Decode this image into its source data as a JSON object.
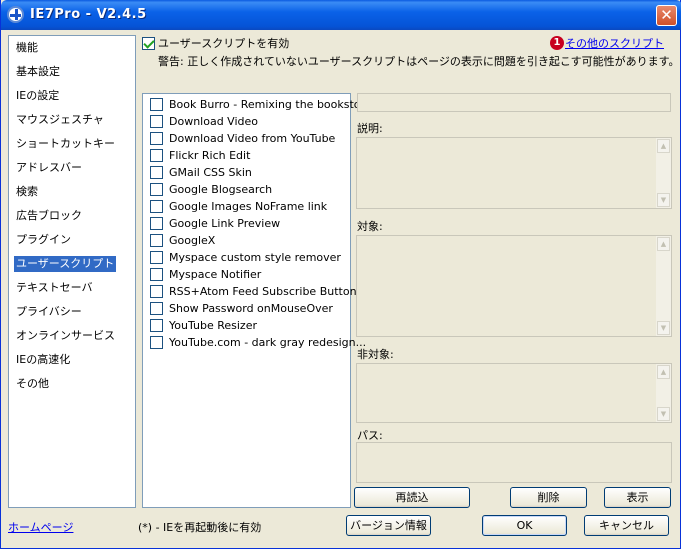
{
  "window": {
    "title": "IE7Pro - V2.4.5"
  },
  "nav": {
    "items": [
      {
        "label": "機能",
        "active": false
      },
      {
        "label": "基本設定",
        "active": false
      },
      {
        "label": "IEの設定",
        "active": false
      },
      {
        "label": "マウスジェスチャ",
        "active": false
      },
      {
        "label": "ショートカットキー",
        "active": false
      },
      {
        "label": "アドレスバー",
        "active": false
      },
      {
        "label": "検索",
        "active": false
      },
      {
        "label": "広告ブロック",
        "active": false
      },
      {
        "label": "プラグイン",
        "active": false
      },
      {
        "label": "ユーザースクリプト",
        "active": true
      },
      {
        "label": "テキストセーバ",
        "active": false
      },
      {
        "label": "プライバシー",
        "active": false
      },
      {
        "label": "オンラインサービス",
        "active": false
      },
      {
        "label": "IEの高速化",
        "active": false
      },
      {
        "label": "その他",
        "active": false
      }
    ]
  },
  "userscripts": {
    "enable_label": "ユーザースクリプトを有効",
    "enable_checked": true,
    "warning": "警告: 正しく作成されていないユーザースクリプトはページの表示に問題を引き起こす可能性があります。",
    "badge": "1",
    "other_scripts_link": "その他のスクリプト",
    "scripts": [
      {
        "name": "Book Burro - Remixing the bookstore",
        "checked": false
      },
      {
        "name": "Download Video",
        "checked": false
      },
      {
        "name": "Download Video from YouTube",
        "checked": false
      },
      {
        "name": "Flickr Rich Edit",
        "checked": false
      },
      {
        "name": "GMail CSS Skin",
        "checked": false
      },
      {
        "name": "Google Blogsearch",
        "checked": false
      },
      {
        "name": "Google Images NoFrame link",
        "checked": false
      },
      {
        "name": "Google Link Preview",
        "checked": false
      },
      {
        "name": "GoogleX",
        "checked": false
      },
      {
        "name": "Myspace custom style remover",
        "checked": false
      },
      {
        "name": "Myspace Notifier",
        "checked": false
      },
      {
        "name": "RSS+Atom Feed Subscribe Button ...",
        "checked": false
      },
      {
        "name": "Show Password onMouseOver",
        "checked": false
      },
      {
        "name": "YouTube Resizer",
        "checked": false
      },
      {
        "name": "YouTube.com - dark gray redesign...",
        "checked": false
      }
    ],
    "details": {
      "name_value": "",
      "description_label": "説明:",
      "target_label": "対象:",
      "exclude_label": "非対象:",
      "path_label": "パス:"
    },
    "buttons": {
      "reload": "再読込",
      "delete": "削除",
      "show": "表示"
    }
  },
  "footer": {
    "home_link": "ホームページ",
    "note": "(*) - IEを再起動後に有効",
    "version_button": "バージョン情報",
    "ok_button": "OK",
    "cancel_button": "キャンセル"
  },
  "icons": {
    "app": "ie7pro-app-icon",
    "close": "close-icon",
    "scroll_up": "scroll-up-arrow-icon",
    "scroll_down": "scroll-down-arrow-icon"
  },
  "colors": {
    "titlebar": "#0a5ae0",
    "selection": "#316ac5",
    "window_bg": "#ece9d8",
    "badge": "#c8001e",
    "link": "#0000ee"
  }
}
